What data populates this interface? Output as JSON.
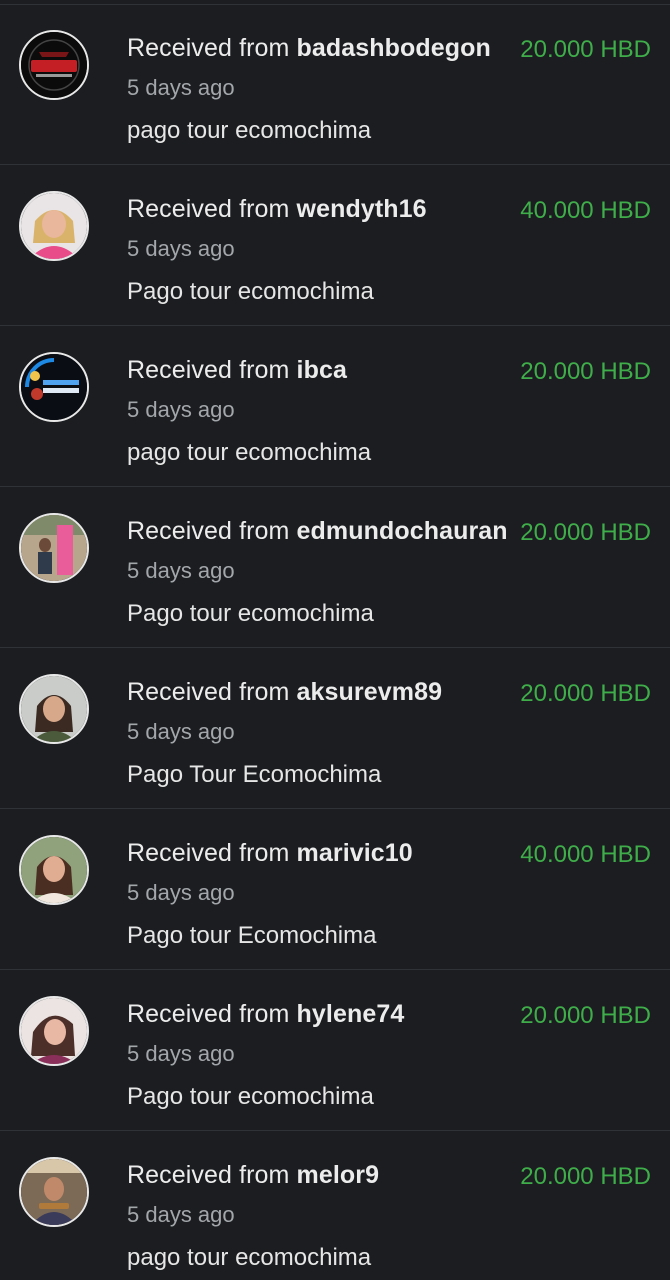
{
  "colors": {
    "background": "#1b1d20",
    "amount_green": "#3fae4a",
    "divider": "#2f3236"
  },
  "transactions": [
    {
      "prefix": "Received from",
      "user": "badashbodegon",
      "time": "5 days ago",
      "memo": "pago tour ecomochima",
      "amount": "20.000 HBD",
      "avatar_icon": "badash-bodegon-logo-avatar"
    },
    {
      "prefix": "Received from",
      "user": "wendyth16",
      "time": "5 days ago",
      "memo": "Pago tour ecomochima",
      "amount": "40.000 HBD",
      "avatar_icon": "user-photo-avatar"
    },
    {
      "prefix": "Received from",
      "user": "ibca",
      "time": "5 days ago",
      "memo": "pago tour ecomochima",
      "amount": "20.000 HBD",
      "avatar_icon": "inversiones-brito-logo-avatar"
    },
    {
      "prefix": "Received from",
      "user": "edmundochauran",
      "time": "5 days ago",
      "memo": "Pago tour ecomochima",
      "amount": "20.000 HBD",
      "avatar_icon": "user-photo-avatar"
    },
    {
      "prefix": "Received from",
      "user": "aksurevm89",
      "time": "5 days ago",
      "memo": "Pago Tour Ecomochima",
      "amount": "20.000 HBD",
      "avatar_icon": "user-photo-avatar"
    },
    {
      "prefix": "Received from",
      "user": "marivic10",
      "time": "5 days ago",
      "memo": "Pago tour Ecomochima",
      "amount": "40.000 HBD",
      "avatar_icon": "user-photo-avatar"
    },
    {
      "prefix": "Received from",
      "user": "hylene74",
      "time": "5 days ago",
      "memo": "Pago tour ecomochima",
      "amount": "20.000 HBD",
      "avatar_icon": "user-photo-avatar"
    },
    {
      "prefix": "Received from",
      "user": "melor9",
      "time": "5 days ago",
      "memo": "pago tour ecomochima",
      "amount": "20.000 HBD",
      "avatar_icon": "user-photo-avatar"
    }
  ]
}
